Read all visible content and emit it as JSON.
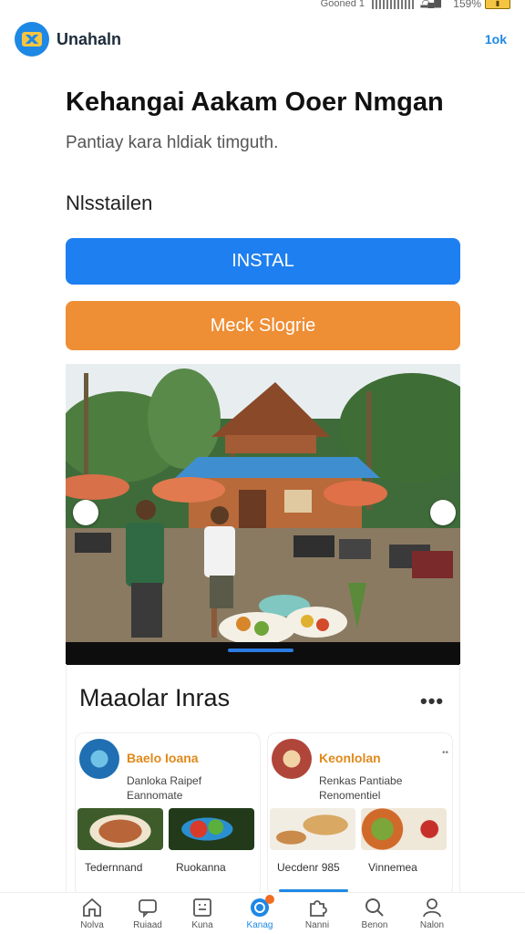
{
  "status_bar": {
    "carrier": "Gooned 1",
    "battery_pct": "159%"
  },
  "app": {
    "name": "Unahaln",
    "action": "1ok"
  },
  "headline": "Kehangai Aakam Ooer Nmgan",
  "subline": "Pantiay kara hldiak timguth.",
  "section_label": "Nlsstailen",
  "buttons": {
    "install": "INSTAL",
    "secondary": "Meck Slogrie"
  },
  "section": {
    "title": "Maaolar Inras"
  },
  "cards": [
    {
      "name": "Baelo Ioana",
      "desc": "Danloka Raipef Eannomate",
      "captions": [
        "Tedernnand",
        "Ruokanna"
      ],
      "name_color": "#e0891a"
    },
    {
      "name": "Keonlolan",
      "desc": "Renkas Pantiabe Renomentiel",
      "captions": [
        "Uecdenr 985",
        "Vinnemea"
      ],
      "name_color": "#e0891a"
    }
  ],
  "tabs": [
    {
      "label": "Nolva",
      "icon": "home-icon"
    },
    {
      "label": "Ruiaad",
      "icon": "chat-icon"
    },
    {
      "label": "Kuna",
      "icon": "grid-icon"
    },
    {
      "label": "Kanag",
      "icon": "camera-icon",
      "active": true,
      "badge": "1"
    },
    {
      "label": "Nanni",
      "icon": "puzzle-icon"
    },
    {
      "label": "Benon",
      "icon": "search-icon"
    },
    {
      "label": "Nalon",
      "icon": "profile-icon"
    }
  ],
  "colors": {
    "primary": "#1e7ff0",
    "secondary": "#ee8e35"
  }
}
